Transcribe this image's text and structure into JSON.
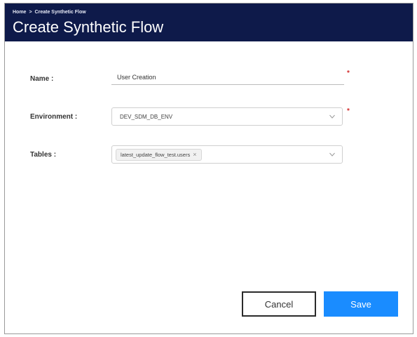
{
  "header": {
    "breadcrumb": {
      "home": "Home",
      "separator": ">",
      "current": "Create Synthetic Flow"
    },
    "title": "Create Synthetic Flow"
  },
  "form": {
    "name": {
      "label": "Name :",
      "value": "User Creation",
      "required_mark": "*"
    },
    "environment": {
      "label": "Environment :",
      "value": "DEV_SDM_DB_ENV",
      "required_mark": "*",
      "icon": "chevron-down-icon"
    },
    "tables": {
      "label": "Tables :",
      "chips": [
        "latest_update_flow_test.users"
      ],
      "chip_remove": "×",
      "icon": "chevron-down-icon"
    }
  },
  "actions": {
    "cancel_label": "Cancel",
    "save_label": "Save"
  },
  "colors": {
    "header_bg": "#0e1a4a",
    "primary": "#1a8cff",
    "required": "#d32f2f"
  }
}
